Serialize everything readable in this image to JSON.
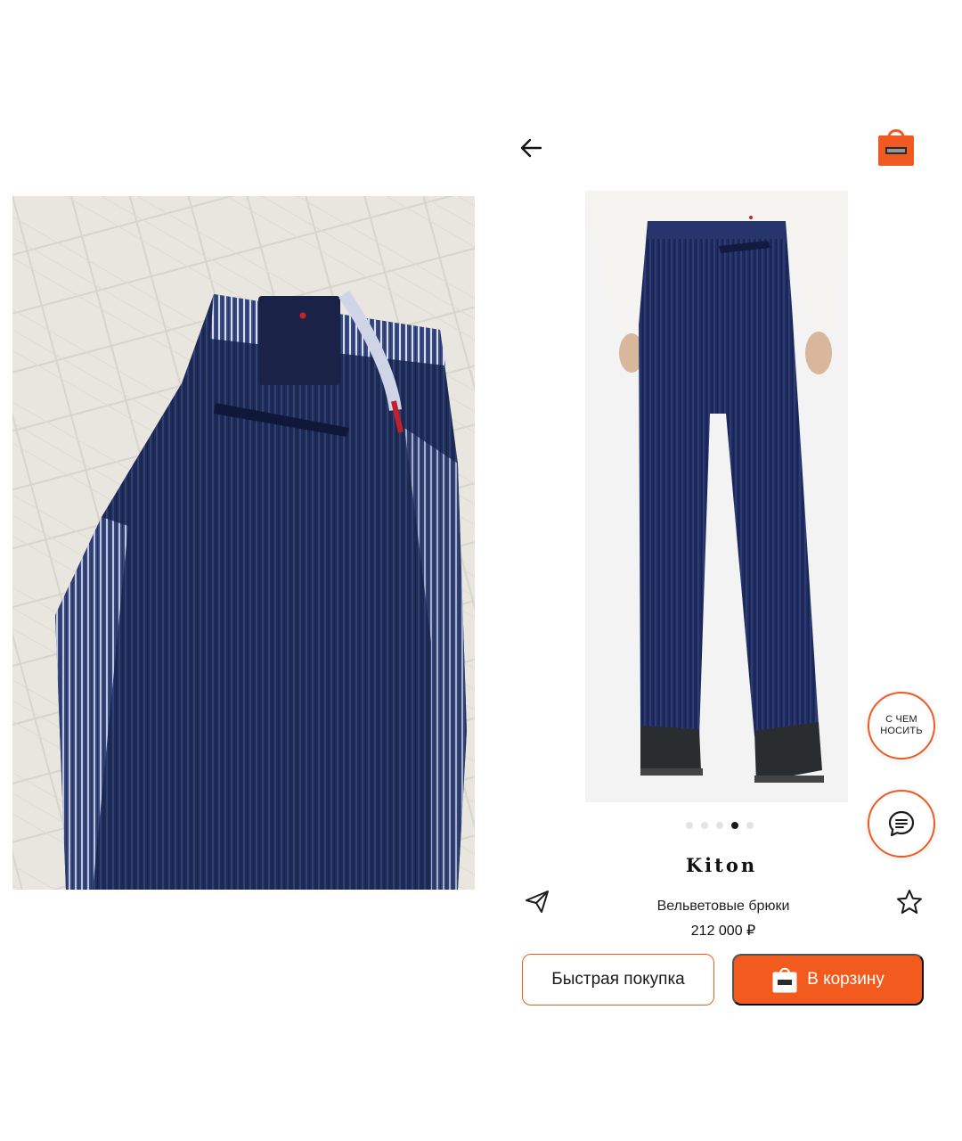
{
  "header": {
    "back_icon": "arrow-left-icon",
    "cart_icon": "shopping-bag-icon"
  },
  "gallery": {
    "image_count": 5,
    "active_index": 3
  },
  "fabs": {
    "wear_with_label": "С ЧЕМ\nНОСИТЬ",
    "chat_icon": "chat-bubble-icon"
  },
  "product": {
    "brand": "Kiton",
    "name": "Вельветовые брюки",
    "price": "212 000 ₽"
  },
  "actions": {
    "quick_buy_label": "Быстрая покупка",
    "add_to_cart_label": "В корзину"
  },
  "colors": {
    "accent": "#f05a22",
    "navy": "#1f2e5c"
  }
}
